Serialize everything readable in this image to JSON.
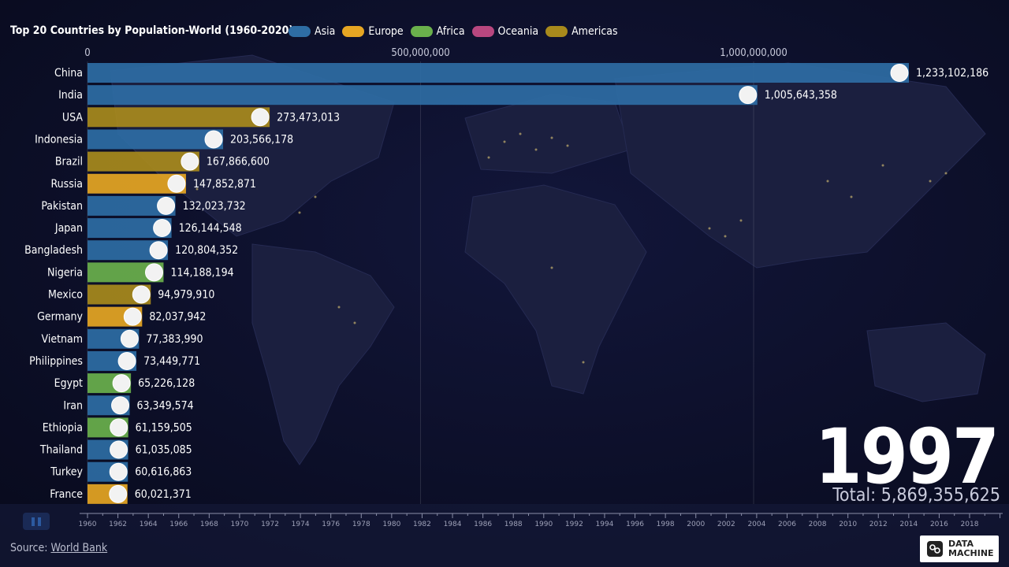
{
  "title": "Top 20 Countries by Population-World (1960-2020)",
  "legend": [
    {
      "name": "Asia",
      "color": "#2e6da4"
    },
    {
      "name": "Europe",
      "color": "#e6a623"
    },
    {
      "name": "Africa",
      "color": "#6ab04c"
    },
    {
      "name": "Oceania",
      "color": "#b8477f"
    },
    {
      "name": "Americas",
      "color": "#a88a1c"
    }
  ],
  "year": "1997",
  "total": "Total: 5,869,355,625",
  "source_label": "Source:",
  "source_link": "World Bank",
  "brand": {
    "line1": "DATA",
    "line2": "MACHINE"
  },
  "chart_data": {
    "type": "bar",
    "title": "Top 20 Countries by Population-World (1960-2020)",
    "orientation": "horizontal",
    "xlim": [
      0,
      1250000000
    ],
    "x_ticks": [
      0,
      500000000,
      1000000000
    ],
    "x_tick_labels": [
      "0",
      "500,000,000",
      "1,000,000,000"
    ],
    "categories": [
      "China",
      "India",
      "USA",
      "Indonesia",
      "Brazil",
      "Russia",
      "Pakistan",
      "Japan",
      "Bangladesh",
      "Nigeria",
      "Mexico",
      "Germany",
      "Vietnam",
      "Philippines",
      "Egypt",
      "Iran",
      "Ethiopia",
      "Thailand",
      "Turkey",
      "France"
    ],
    "values": [
      1233102186,
      1005643358,
      273473013,
      203566178,
      167866600,
      147852871,
      132023732,
      126144548,
      120804352,
      114188194,
      94979910,
      82037942,
      77383990,
      73449771,
      65226128,
      63349574,
      61159505,
      61035085,
      60616863,
      60021371
    ],
    "value_labels": [
      "1,233,102,186",
      "1,005,643,358",
      "273,473,013",
      "203,566,178",
      "167,866,600",
      "147,852,871",
      "132,023,732",
      "126,144,548",
      "120,804,352",
      "114,188,194",
      "94,979,910",
      "82,037,942",
      "77,383,990",
      "73,449,771",
      "65,226,128",
      "63,349,574",
      "61,159,505",
      "61,035,085",
      "60,616,863",
      "60,021,371"
    ],
    "regions": [
      "Asia",
      "Asia",
      "Americas",
      "Asia",
      "Americas",
      "Europe",
      "Asia",
      "Asia",
      "Asia",
      "Africa",
      "Americas",
      "Europe",
      "Asia",
      "Asia",
      "Africa",
      "Asia",
      "Africa",
      "Asia",
      "Asia",
      "Europe"
    ],
    "timeline": {
      "start": 1960,
      "end": 2020,
      "current": 1997,
      "labels": [
        "1960",
        "1962",
        "1964",
        "1966",
        "1968",
        "1970",
        "1972",
        "1974",
        "1976",
        "1978",
        "1980",
        "1982",
        "1984",
        "1986",
        "1988",
        "1990",
        "1992",
        "1994",
        "1996",
        "1998",
        "2000",
        "2002",
        "2004",
        "2006",
        "2008",
        "2010",
        "2012",
        "2014",
        "2016",
        "2018"
      ]
    }
  }
}
